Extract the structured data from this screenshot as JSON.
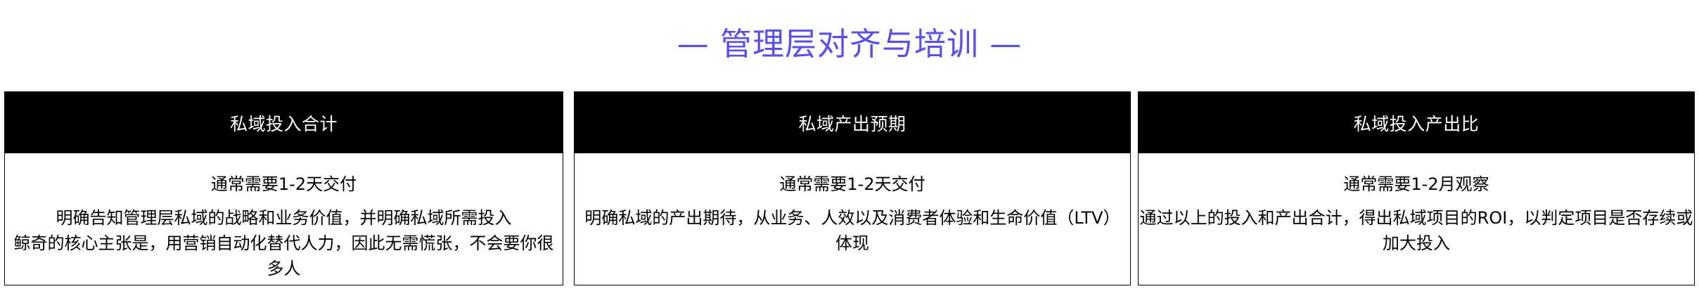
{
  "section": {
    "title": "— 管理层对齐与培训 —",
    "accent_color": "#5b4fe9"
  },
  "cards": [
    {
      "header": "私域投入合计",
      "timing": "通常需要1-2天交付",
      "desc_lines": [
        "明确告知管理层私域的战略和业务价值，并明确私域所需投入",
        "鲸奇的核心主张是，用营销自动化替代人力，因此无需慌张，不会要你很",
        "多人"
      ]
    },
    {
      "header": "私域产出预期",
      "timing": "通常需要1-2天交付",
      "desc_lines": [
        "明确私域的产出期待，从业务、人效以及消费者体验和生命价值（LTV）",
        "体现"
      ]
    },
    {
      "header": "私域投入产出比",
      "timing": "通常需要1-2月观察",
      "desc_lines": [
        "通过以上的投入和产出合计，得出私域项目的ROI，以判定项目是否存续或",
        "加大投入"
      ]
    }
  ]
}
